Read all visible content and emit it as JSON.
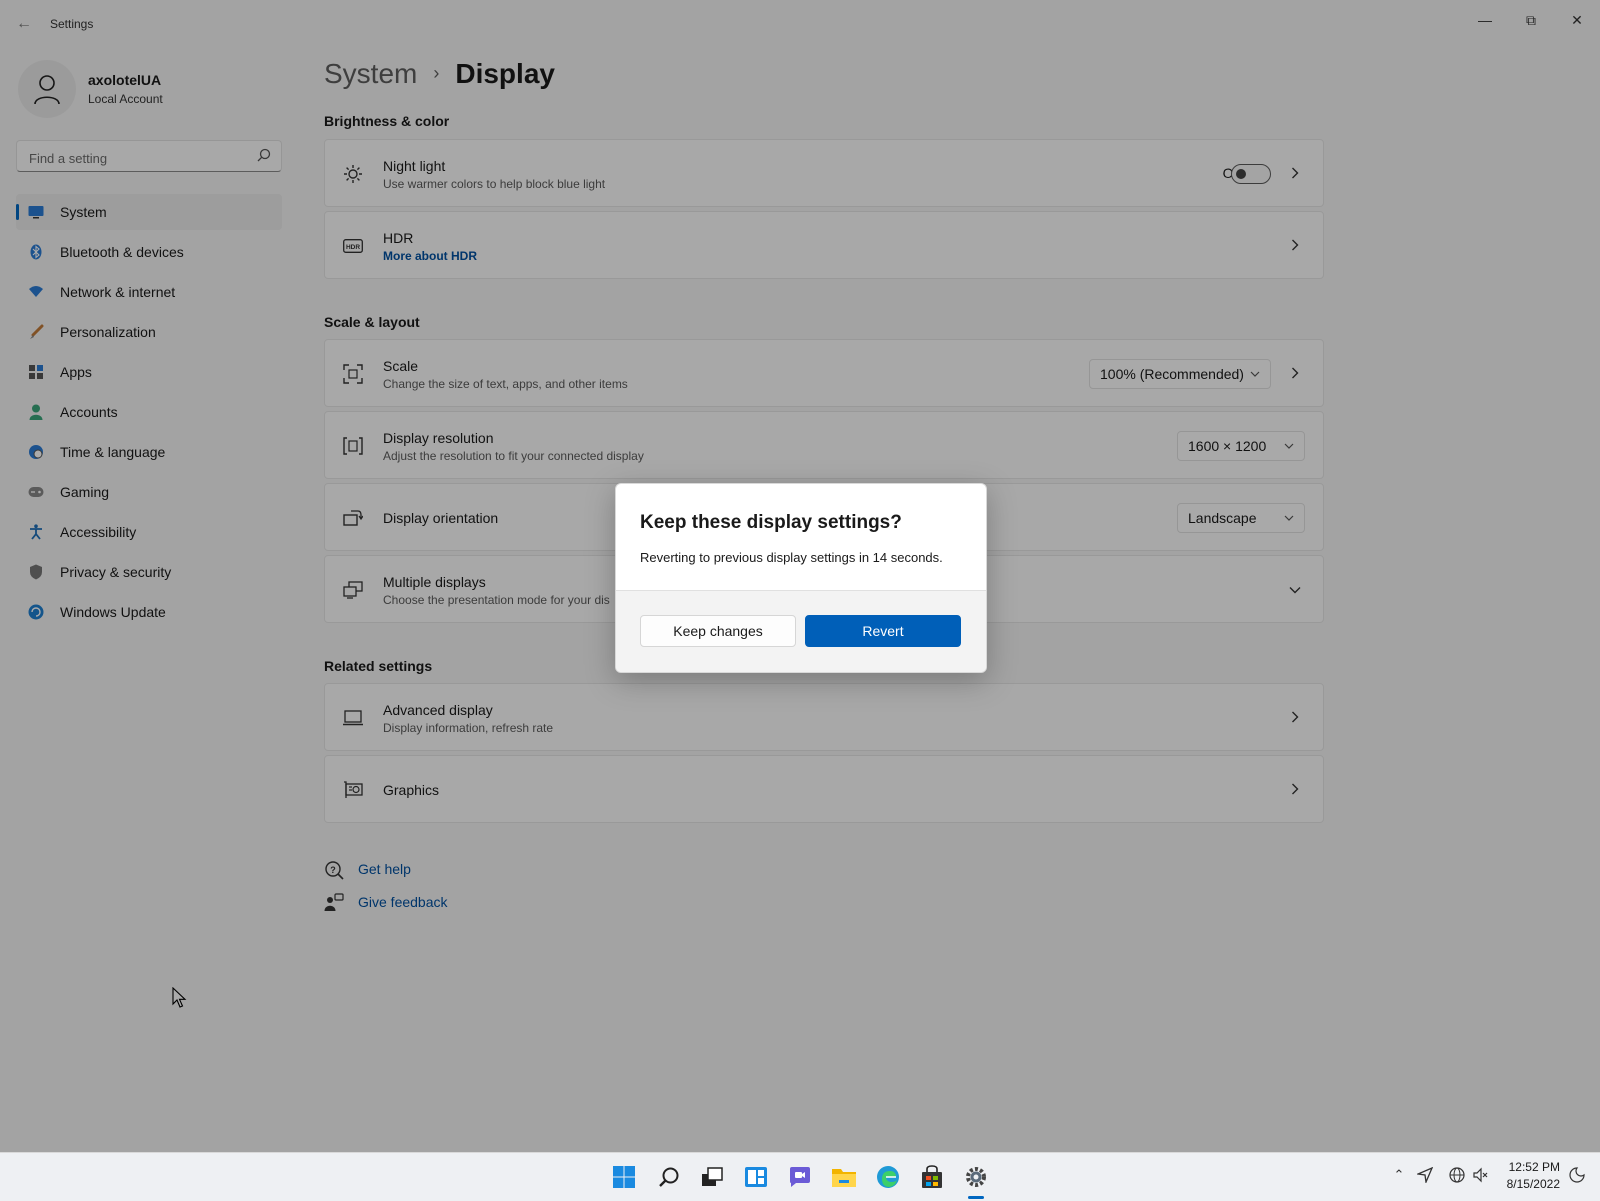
{
  "window": {
    "title": "Settings"
  },
  "user": {
    "name": "axolotelUA",
    "account_type": "Local Account"
  },
  "search": {
    "placeholder": "Find a setting"
  },
  "nav": [
    {
      "label": "System",
      "icon": "monitor-icon",
      "active": true
    },
    {
      "label": "Bluetooth & devices",
      "icon": "bluetooth-icon"
    },
    {
      "label": "Network & internet",
      "icon": "wifi-icon"
    },
    {
      "label": "Personalization",
      "icon": "brush-icon"
    },
    {
      "label": "Apps",
      "icon": "apps-icon"
    },
    {
      "label": "Accounts",
      "icon": "person-icon"
    },
    {
      "label": "Time & language",
      "icon": "globe-clock-icon"
    },
    {
      "label": "Gaming",
      "icon": "gamepad-icon"
    },
    {
      "label": "Accessibility",
      "icon": "accessibility-icon"
    },
    {
      "label": "Privacy & security",
      "icon": "shield-icon"
    },
    {
      "label": "Windows Update",
      "icon": "update-icon"
    }
  ],
  "breadcrumb": {
    "parent": "System",
    "separator": "›",
    "current": "Display"
  },
  "sections": {
    "brightness": "Brightness & color",
    "scale": "Scale & layout",
    "related": "Related settings"
  },
  "settings": {
    "night_light": {
      "title": "Night light",
      "subtitle": "Use warmer colors to help block blue light",
      "state_label": "Off",
      "enabled": false
    },
    "hdr": {
      "title": "HDR",
      "link": "More about HDR"
    },
    "scale": {
      "title": "Scale",
      "subtitle": "Change the size of text, apps, and other items",
      "value": "100% (Recommended)"
    },
    "resolution": {
      "title": "Display resolution",
      "subtitle": "Adjust the resolution to fit your connected display",
      "value": "1600 × 1200"
    },
    "orientation": {
      "title": "Display orientation",
      "value": "Landscape"
    },
    "multiple": {
      "title": "Multiple displays",
      "subtitle": "Choose the presentation mode for your dis"
    },
    "advanced": {
      "title": "Advanced display",
      "subtitle": "Display information, refresh rate"
    },
    "graphics": {
      "title": "Graphics"
    }
  },
  "help": {
    "get_help": "Get help",
    "feedback": "Give feedback"
  },
  "dialog": {
    "title": "Keep these display settings?",
    "message": "Reverting to previous display settings in 14 seconds.",
    "keep_label": "Keep changes",
    "revert_label": "Revert"
  },
  "taskbar": {
    "apps": [
      "start-icon",
      "search-icon",
      "task-view-icon",
      "widgets-icon",
      "chat-icon",
      "file-explorer-icon",
      "edge-icon",
      "store-icon",
      "settings-icon"
    ],
    "time": "12:52 PM",
    "date": "8/15/2022"
  },
  "colors": {
    "accent": "#005fb8",
    "link": "#0050a0",
    "background": "#f3f3f3"
  }
}
